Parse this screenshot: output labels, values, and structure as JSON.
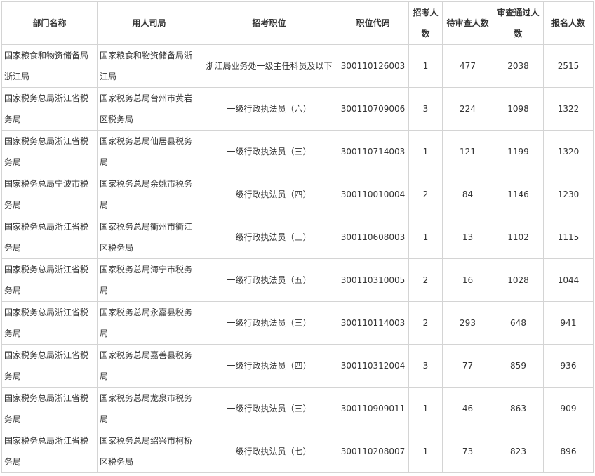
{
  "table": {
    "headers": {
      "department": "部门名称",
      "employer": "用人司局",
      "position": "招考职位",
      "code": "职位代码",
      "quota": "招考人数",
      "pending": "待审查人数",
      "approved": "审查通过人数",
      "applicants": "报名人数"
    },
    "rows": [
      [
        "国家粮食和物资储备局浙江局",
        "国家粮食和物资储备局浙江局",
        "浙江局业务处一级主任科员及以下",
        "300110126003",
        "1",
        "477",
        "2038",
        "2515"
      ],
      [
        "国家税务总局浙江省税务局",
        "国家税务总局台州市黄岩区税务局",
        "一级行政执法员（六）",
        "300110709006",
        "3",
        "224",
        "1098",
        "1322"
      ],
      [
        "国家税务总局浙江省税务局",
        "国家税务总局仙居县税务局",
        "一级行政执法员（三）",
        "300110714003",
        "1",
        "121",
        "1199",
        "1320"
      ],
      [
        "国家税务总局宁波市税务局",
        "国家税务总局余姚市税务局",
        "一级行政执法员（四）",
        "300110010004",
        "2",
        "84",
        "1146",
        "1230"
      ],
      [
        "国家税务总局浙江省税务局",
        "国家税务总局衢州市衢江区税务局",
        "一级行政执法员（三）",
        "300110608003",
        "1",
        "13",
        "1102",
        "1115"
      ],
      [
        "国家税务总局浙江省税务局",
        "国家税务总局海宁市税务局",
        "一级行政执法员（五）",
        "300110310005",
        "2",
        "16",
        "1028",
        "1044"
      ],
      [
        "国家税务总局浙江省税务局",
        "国家税务总局永嘉县税务局",
        "一级行政执法员（三）",
        "300110114003",
        "2",
        "293",
        "648",
        "941"
      ],
      [
        "国家税务总局浙江省税务局",
        "国家税务总局嘉善县税务局",
        "一级行政执法员（四）",
        "300110312004",
        "3",
        "77",
        "859",
        "936"
      ],
      [
        "国家税务总局浙江省税务局",
        "国家税务总局龙泉市税务局",
        "一级行政执法员（三）",
        "300110909011",
        "1",
        "46",
        "863",
        "909"
      ],
      [
        "国家税务总局浙江省税务局",
        "国家税务总局绍兴市柯桥区税务局",
        "一级行政执法员（七）",
        "300110208007",
        "1",
        "73",
        "823",
        "896"
      ]
    ]
  }
}
